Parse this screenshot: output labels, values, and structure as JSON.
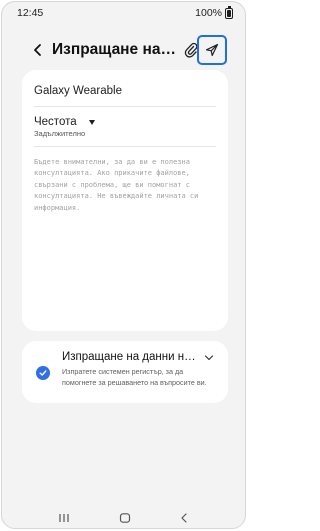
{
  "status_bar": {
    "time": "12:45",
    "battery": "100%"
  },
  "header": {
    "title": "Изпращане на обратна връзка",
    "back_icon": "chevron-left-icon",
    "attach_icon": "paperclip-icon",
    "send_icon": "send-icon",
    "send_highlight_color": "#1f6fe0"
  },
  "form": {
    "product": "Galaxy Wearable",
    "category": {
      "selected": "Честота",
      "required_label": "Задължително"
    },
    "message": {
      "value": "",
      "placeholder": "Бъдете внимателни, за да ви е полезна консултацията. Ако прикачите файлове, свързани с проблема, ще ви помогнат с консултацията. Не въвеждайте личната си информация."
    }
  },
  "log_option": {
    "checked": true,
    "title": "Изпращане на данни на регистър",
    "description": "Изпратете системен регистър, за да помогнете за решаването на въпросите ви.",
    "accent_color": "#2f6fe0"
  },
  "nav_bar": {
    "recents_icon": "recents-icon",
    "home_icon": "home-icon",
    "back_icon": "back-icon"
  }
}
